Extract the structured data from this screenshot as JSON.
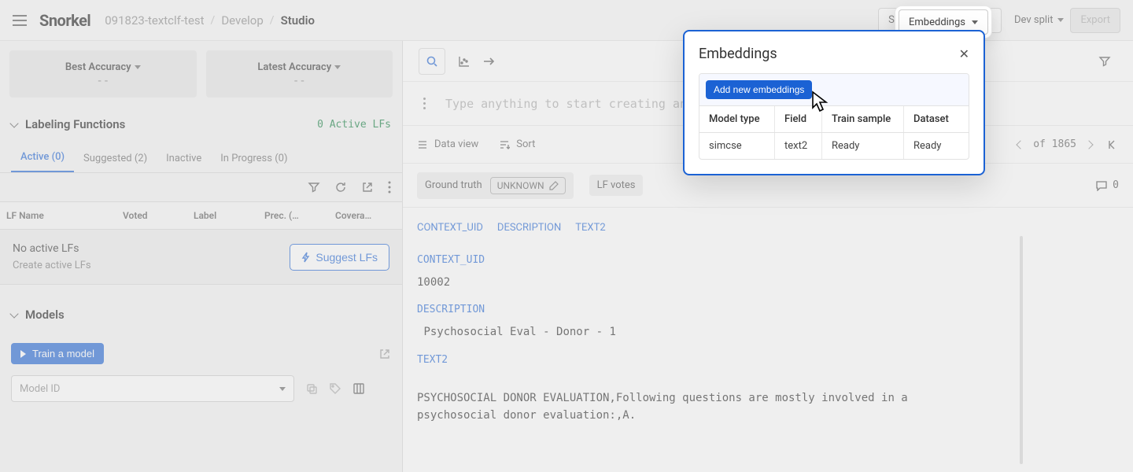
{
  "brand": "Snorkel",
  "breadcrumbs": {
    "project": "091823-textclf-test",
    "section": "Develop",
    "page": "Studio"
  },
  "nav": {
    "shared_resources": "Shared resources",
    "embeddings": "Embeddings",
    "dev_split": "Dev split",
    "export": "Export"
  },
  "metrics": {
    "best_label": "Best Accuracy",
    "best_value": "--",
    "latest_label": "Latest Accuracy",
    "latest_value": "--"
  },
  "lf": {
    "section_title": "Labeling Functions",
    "status": "0 Active LFs",
    "tabs": {
      "active": "Active (0)",
      "suggested": "Suggested (2)",
      "inactive": "Inactive",
      "inprogress": "In Progress (0)"
    },
    "cols": {
      "name": "LF Name",
      "voted": "Voted",
      "label": "Label",
      "prec": "Prec. (…",
      "cov": "Covera…"
    },
    "empty_title": "No active LFs",
    "empty_sub": "Create active LFs",
    "suggest_btn": "Suggest LFs"
  },
  "models": {
    "section_title": "Models",
    "train_btn": "Train a model",
    "select_placeholder": "Model ID"
  },
  "studio": {
    "search_placeholder": "Type anything to start creating an",
    "data_view": "Data view",
    "sort": "Sort",
    "counter_of": "of 1865",
    "ground_truth_label": "Ground truth",
    "ground_truth_value": "UNKNOWN",
    "lf_votes_label": "LF votes",
    "comments": "0",
    "field_links": {
      "a": "CONTEXT_UID",
      "b": "DESCRIPTION",
      "c": "TEXT2"
    },
    "fields": {
      "context_uid": {
        "key": "CONTEXT_UID",
        "val": "10002"
      },
      "description": {
        "key": "DESCRIPTION",
        "val": " Psychosocial Eval - Donor - 1"
      },
      "text2": {
        "key": "TEXT2",
        "val": "PSYCHOSOCIAL DONOR EVALUATION,Following questions are mostly involved in a psychosocial donor evaluation:,A."
      }
    }
  },
  "popover": {
    "title": "Embeddings",
    "add_btn": "Add new embeddings",
    "cols": {
      "model": "Model type",
      "field": "Field",
      "train": "Train sample",
      "dataset": "Dataset"
    },
    "rows": [
      {
        "model": "simcse",
        "field": "text2",
        "train": "Ready",
        "dataset": "Ready"
      }
    ]
  }
}
